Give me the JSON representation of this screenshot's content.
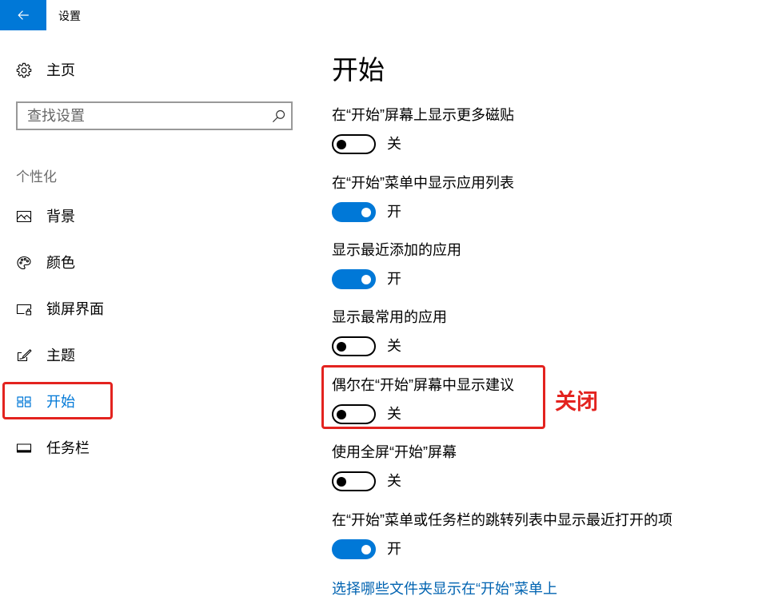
{
  "window": {
    "title": "设置",
    "back_button_icon": "back-arrow-icon"
  },
  "colors": {
    "accent": "#0078D7",
    "link": "#0063B1",
    "annotation": "#E3231F",
    "text": "#000000",
    "muted": "#6B6B6B",
    "search_border": "#999999"
  },
  "sidebar": {
    "home": {
      "label": "主页",
      "icon": "gear-icon"
    },
    "search": {
      "placeholder": "查找设置",
      "value": "",
      "icon": "search-icon"
    },
    "section_heading": "个性化",
    "items": [
      {
        "label": "背景",
        "icon": "picture-icon",
        "selected": false
      },
      {
        "label": "颜色",
        "icon": "palette-icon",
        "selected": false
      },
      {
        "label": "锁屏界面",
        "icon": "lock-screen-icon",
        "selected": false
      },
      {
        "label": "主题",
        "icon": "theme-icon",
        "selected": false
      },
      {
        "label": "开始",
        "icon": "start-tiles-icon",
        "selected": true
      },
      {
        "label": "任务栏",
        "icon": "taskbar-icon",
        "selected": false
      }
    ]
  },
  "main": {
    "title": "开始",
    "settings": [
      {
        "label": "在“开始”屏幕上显示更多磁贴",
        "on": false,
        "state_label": "关"
      },
      {
        "label": "在“开始”菜单中显示应用列表",
        "on": true,
        "state_label": "开"
      },
      {
        "label": "显示最近添加的应用",
        "on": true,
        "state_label": "开"
      },
      {
        "label": "显示最常用的应用",
        "on": false,
        "state_label": "关"
      },
      {
        "label": "偶尔在“开始”屏幕中显示建议",
        "on": false,
        "state_label": "关"
      },
      {
        "label": "使用全屏“开始”屏幕",
        "on": false,
        "state_label": "关"
      },
      {
        "label": "在“开始”菜单或任务栏的跳转列表中显示最近打开的项",
        "on": true,
        "state_label": "开"
      }
    ],
    "folders_link": "选择哪些文件夹显示在“开始”菜单上"
  },
  "annotations": {
    "callout_text": "关闭"
  }
}
